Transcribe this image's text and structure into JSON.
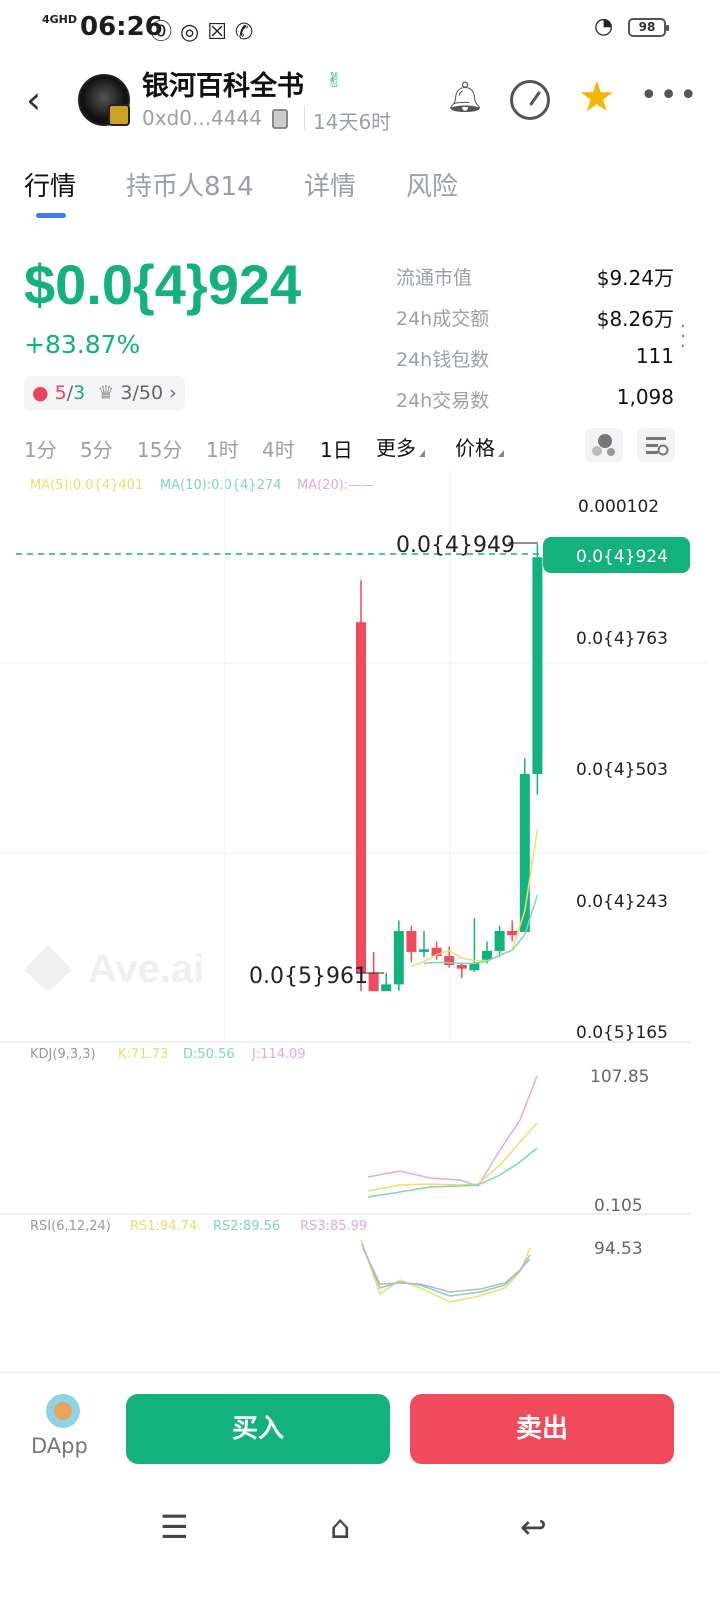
{
  "status": {
    "network": "4GHD",
    "time": "06:26",
    "battery": "98"
  },
  "header": {
    "token_name": "银河百科全书",
    "address": "0xd0...4444",
    "age": "14天6时"
  },
  "tabs": [
    "行情",
    "持币人814",
    "详情",
    "风险"
  ],
  "price": {
    "value": "$0.0{4}924",
    "change": "+83.87%",
    "badge_a_red": "5",
    "badge_a_slash": "/",
    "badge_a_green": "3",
    "badge_b": "3/50"
  },
  "stats": [
    {
      "label": "流通市值",
      "value": "$9.24万"
    },
    {
      "label": "24h成交额",
      "value": "$8.26万"
    },
    {
      "label": "24h钱包数",
      "value": "111"
    },
    {
      "label": "24h交易数",
      "value": "1,098"
    }
  ],
  "intervals": [
    "1分",
    "5分",
    "15分",
    "1时",
    "4时",
    "1日"
  ],
  "dropdowns": [
    "更多",
    "价格"
  ],
  "ma_legend": {
    "ma5": "MA(5):0.0{4}401",
    "ma10": "MA(10):0.0{4}274",
    "ma20": "MA(20):——"
  },
  "kdj_legend": {
    "label": "KDJ(9,3,3)",
    "k": "K:71.73",
    "d": "D:50.56",
    "j": "J:114.09"
  },
  "rsi_legend": {
    "label": "RSI(6,12,24)",
    "rs1": "RS1:94.74",
    "rs2": "RS2:89.56",
    "rs3": "RS3:85.99"
  },
  "price_axis": [
    "0.000102",
    "0.0{4}763",
    "0.0{4}503",
    "0.0{4}243",
    "0.0{5}165"
  ],
  "current_price_tag": "0.0{4}924",
  "high_label": "0.0{4}949",
  "low_label": "0.0{5}961",
  "kdj_axis": [
    "107.85",
    "0.105"
  ],
  "rsi_axis": [
    "94.53"
  ],
  "watermark": "Ave.ai",
  "colors": {
    "up": "#13b27c",
    "down": "#f04a5c",
    "ma5": "#f2dc6b",
    "ma10": "#7fd6b6",
    "ma20": "#e6a6e6"
  },
  "candles": [
    {
      "o": 8e-05,
      "h": 8.8e-05,
      "l": 9.5e-06,
      "c": 1.3e-05
    },
    {
      "o": 1.3e-05,
      "h": 1.7e-05,
      "l": 1.1e-05,
      "c": 9.5e-06
    },
    {
      "o": 9.5e-06,
      "h": 1.3e-05,
      "l": 9.6e-06,
      "c": 1.08e-05
    },
    {
      "o": 1.08e-05,
      "h": 2.3e-05,
      "l": 9.6e-06,
      "c": 2.1e-05
    },
    {
      "o": 2.1e-05,
      "h": 2.2e-05,
      "l": 1.5e-05,
      "c": 1.7e-05
    },
    {
      "o": 1.7e-05,
      "h": 2.1e-05,
      "l": 1.6e-05,
      "c": 1.75e-05
    },
    {
      "o": 1.78e-05,
      "h": 1.9e-05,
      "l": 1.55e-05,
      "c": 1.62e-05
    },
    {
      "o": 1.62e-05,
      "h": 1.8e-05,
      "l": 1.4e-05,
      "c": 1.45e-05
    },
    {
      "o": 1.45e-05,
      "h": 1.5e-05,
      "l": 1.2e-05,
      "c": 1.38e-05
    },
    {
      "o": 1.35e-05,
      "h": 2.35e-05,
      "l": 1.32e-05,
      "c": 1.48e-05
    },
    {
      "o": 1.55e-05,
      "h": 1.9e-05,
      "l": 1.48e-05,
      "c": 1.72e-05
    },
    {
      "o": 1.72e-05,
      "h": 2.2e-05,
      "l": 1.6e-05,
      "c": 2.1e-05
    },
    {
      "o": 2.1e-05,
      "h": 2.3e-05,
      "l": 1.9e-05,
      "c": 2.02e-05
    },
    {
      "o": 2.08e-05,
      "h": 5.4e-05,
      "l": 2.1e-05,
      "c": 5.1e-05
    },
    {
      "o": 5.1e-05,
      "h": 9.49e-05,
      "l": 4.7e-05,
      "c": 9.24e-05
    }
  ]
}
